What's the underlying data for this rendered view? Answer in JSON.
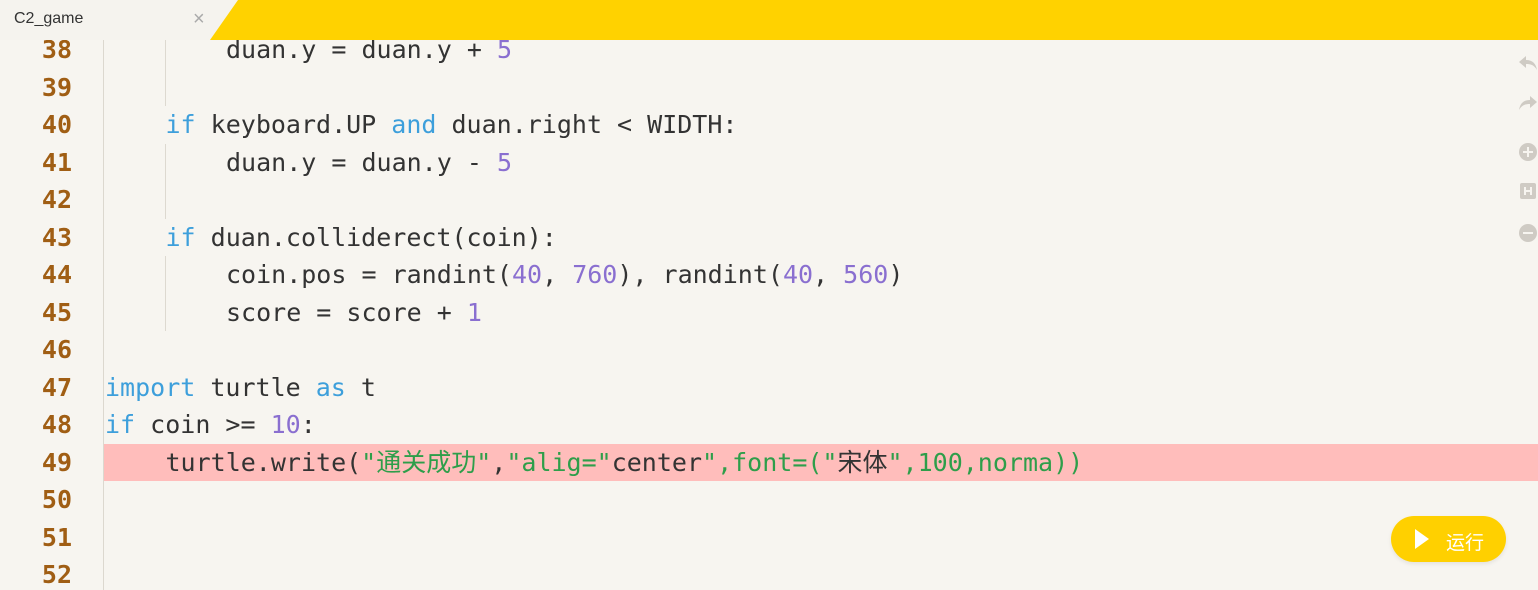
{
  "tab": {
    "title": "C2_game",
    "close": "×"
  },
  "lines": [
    {
      "num": "38",
      "indent": 2,
      "tokens": [
        [
          "pl",
          "duan.y = duan.y + "
        ],
        [
          "num",
          "5"
        ]
      ]
    },
    {
      "num": "39",
      "indent": 2,
      "tokens": []
    },
    {
      "num": "40",
      "indent": 1,
      "tokens": [
        [
          "kw",
          "if"
        ],
        [
          "pl",
          " keyboard.UP "
        ],
        [
          "kw",
          "and"
        ],
        [
          "pl",
          " duan.right < WIDTH:"
        ]
      ]
    },
    {
      "num": "41",
      "indent": 2,
      "tokens": [
        [
          "pl",
          "duan.y = duan.y - "
        ],
        [
          "num",
          "5"
        ]
      ]
    },
    {
      "num": "42",
      "indent": 2,
      "tokens": []
    },
    {
      "num": "43",
      "indent": 1,
      "tokens": [
        [
          "kw",
          "if"
        ],
        [
          "pl",
          " duan.colliderect(coin):"
        ]
      ]
    },
    {
      "num": "44",
      "indent": 2,
      "tokens": [
        [
          "pl",
          "coin.pos = randint("
        ],
        [
          "num",
          "40"
        ],
        [
          "pl",
          ", "
        ],
        [
          "num",
          "760"
        ],
        [
          "pl",
          "), randint("
        ],
        [
          "num",
          "40"
        ],
        [
          "pl",
          ", "
        ],
        [
          "num",
          "560"
        ],
        [
          "pl",
          ")"
        ]
      ]
    },
    {
      "num": "45",
      "indent": 2,
      "tokens": [
        [
          "pl",
          "score = score + "
        ],
        [
          "num",
          "1"
        ]
      ]
    },
    {
      "num": "46",
      "indent": 0,
      "tokens": []
    },
    {
      "num": "47",
      "indent": 0,
      "tokens": [
        [
          "kw",
          "import"
        ],
        [
          "pl",
          " turtle "
        ],
        [
          "kw",
          "as"
        ],
        [
          "pl",
          " t"
        ]
      ]
    },
    {
      "num": "48",
      "indent": 0,
      "tokens": [
        [
          "kw",
          "if"
        ],
        [
          "pl",
          " coin >= "
        ],
        [
          "num",
          "10"
        ],
        [
          "pl",
          ":"
        ]
      ]
    },
    {
      "num": "49",
      "indent": 1,
      "highlight": true,
      "tokens": [
        [
          "pl",
          "turtle.write("
        ],
        [
          "str",
          "\"通关成功\""
        ],
        [
          "pl",
          ","
        ],
        [
          "str",
          "\"alig=\""
        ],
        [
          "pl",
          "center"
        ],
        [
          "str",
          "\",font=(\""
        ],
        [
          "pl",
          "宋体"
        ],
        [
          "str",
          "\",100,norma))"
        ]
      ]
    },
    {
      "num": "50",
      "indent": 0,
      "tokens": []
    },
    {
      "num": "51",
      "indent": 0,
      "tokens": []
    },
    {
      "num": "52",
      "indent": 0,
      "tokens": []
    }
  ],
  "toolbar": {
    "undo": "undo-icon",
    "redo": "redo-icon",
    "zoom_in": "zoom-in-icon",
    "fit": "fit-icon",
    "zoom_out": "zoom-out-icon"
  },
  "run_button": {
    "label": "运行"
  },
  "colors": {
    "accent": "#ffd200",
    "keyword": "#3d9fdb",
    "number": "#8a6fd0",
    "string": "#2e9e4a",
    "line_number": "#a05e14",
    "error_highlight": "#ffbdbb"
  }
}
